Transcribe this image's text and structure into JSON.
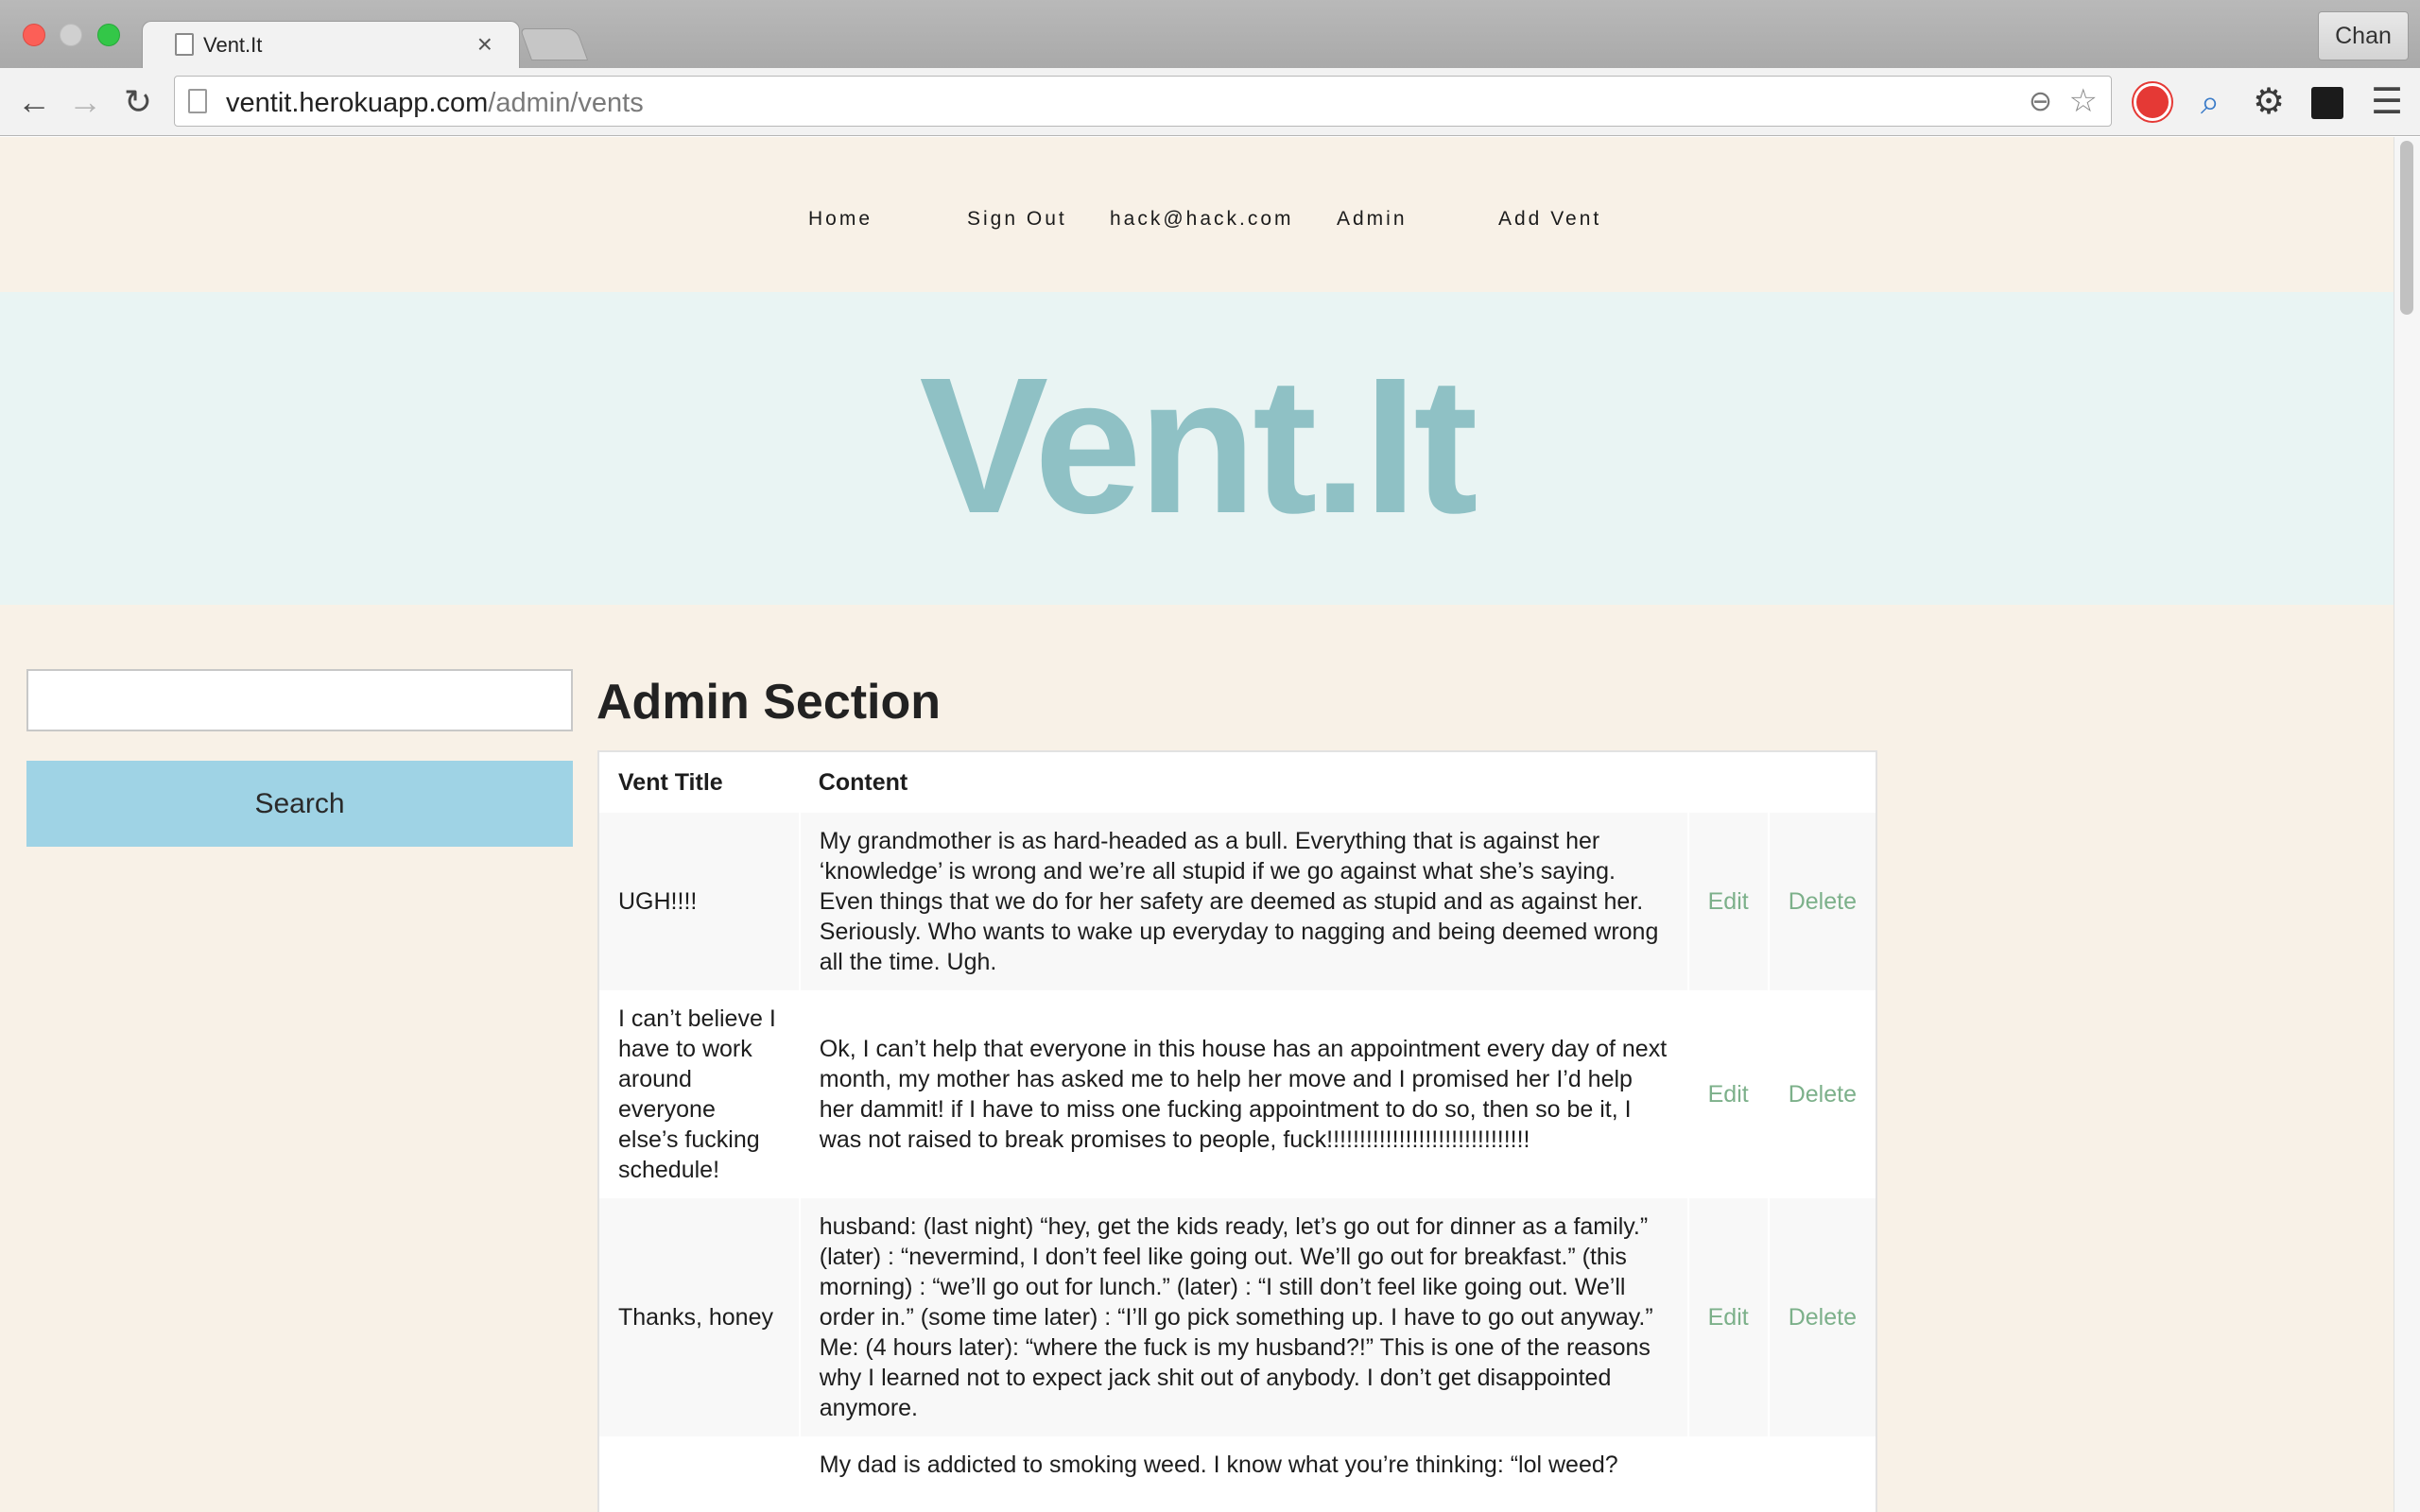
{
  "browser": {
    "tab_title": "Vent.It",
    "tab_close": "×",
    "profile_name": "Chan",
    "url_host": "ventit.herokuapp.com",
    "url_path": "/admin/vents",
    "icons": [
      "back-icon",
      "forward-icon",
      "reload-icon",
      "page-icon",
      "zoom-icon",
      "star-icon",
      "stop-extension-icon",
      "magnify-extension-icon",
      "gear-icon",
      "extension-square-icon",
      "menu-icon"
    ]
  },
  "nav": {
    "home": "Home",
    "sign_out": "Sign Out",
    "email": "hack@hack.com",
    "admin": "Admin",
    "add_vent": "Add Vent"
  },
  "hero": {
    "title": "Vent.It"
  },
  "search": {
    "input_value": "",
    "placeholder": "",
    "button_label": "Search"
  },
  "admin": {
    "heading": "Admin Section",
    "columns": [
      "Vent Title",
      "Content"
    ],
    "rows": [
      {
        "title": "UGH!!!!",
        "content": "My grandmother is as hard-headed as a bull. Everything that is against her ‘knowledge’ is wrong and we’re all stupid if we go against what she’s saying. Even things that we do for her safety are deemed as stupid and as against her. Seriously. Who wants to wake up everyday to nagging and being deemed wrong all the time. Ugh.",
        "edit": "Edit",
        "delete": "Delete"
      },
      {
        "title": "I can’t believe I have to work around everyone else’s fucking schedule!",
        "content": "Ok, I can’t help that everyone in this house has an appointment every day of next month, my mother has asked me to help her move and I promised her I’d help her dammit! if I have to miss one fucking appointment to do so, then so be it, I was not raised to break promises to people, fuck!!!!!!!!!!!!!!!!!!!!!!!!!!!!!!!",
        "edit": "Edit",
        "delete": "Delete"
      },
      {
        "title": "Thanks, honey",
        "content": "husband: (last night) “hey, get the kids ready, let’s go out for dinner as a family.” (later) : “nevermind, I don’t feel like going out. We’ll go out for breakfast.” (this morning) : “we’ll go out for lunch.” (later) : “I still don’t feel like going out. We’ll order in.” (some time later) : “I’ll go pick something up. I have to go out anyway.” Me: (4 hours later): “where the fuck is my husband?!” This is one of the reasons why I learned not to expect jack shit out of anybody. I don’t get disappointed anymore.",
        "edit": "Edit",
        "delete": "Delete"
      },
      {
        "title": "",
        "content": "My dad is addicted to smoking weed. I know what you’re thinking: “lol weed?",
        "edit": "",
        "delete": ""
      }
    ]
  },
  "colors": {
    "page_bg": "#f8f1e7",
    "hero_bg": "#e9f4f3",
    "hero_text": "#8fc1c5",
    "search_button": "#9fd3e5",
    "action_link": "#7cb08a"
  }
}
